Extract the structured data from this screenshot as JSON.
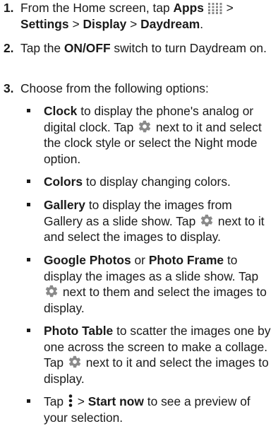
{
  "steps": [
    {
      "number": "1.",
      "parts": {
        "a": "From the Home screen, tap ",
        "b": "Apps",
        "c": " > ",
        "d": "Settings",
        "e": " > ",
        "f": "Display",
        "g": " > ",
        "h": "Daydream",
        "i": "."
      }
    },
    {
      "number": "2.",
      "parts": {
        "a": "Tap the ",
        "b": "ON/OFF",
        "c": " switch to turn Daydream on."
      }
    },
    {
      "number": "3.",
      "parts": {
        "a": "Choose from the following options:"
      }
    }
  ],
  "options": [
    {
      "parts": {
        "a": "Clock",
        "b": " to display the phone's analog or digital clock. Tap ",
        "c": " next to it and select the clock style or select the Night mode option."
      }
    },
    {
      "parts": {
        "a": "Colors",
        "b": " to display changing colors."
      }
    },
    {
      "parts": {
        "a": "Gallery",
        "b": " to display the images from Gallery as a slide show. Tap ",
        "c": " next to it and select the images to display."
      }
    },
    {
      "parts": {
        "a": "Google Photos",
        "b": " or ",
        "c": "Photo Frame",
        "d": " to display the images as a slide show. Tap ",
        "e": " next to them and select the images to display."
      }
    },
    {
      "parts": {
        "a": "Photo Table",
        "b": " to scatter the images one by one across the screen to make a collage. Tap ",
        "c": " next to it and select the images to display."
      }
    },
    {
      "parts": {
        "a": "Tap ",
        "b": " > ",
        "c": "Start now",
        "d": " to see a preview of your selection."
      }
    }
  ],
  "icons": {
    "apps": "apps-grid-icon",
    "settings": "gear-icon",
    "menu": "more-vertical-icon"
  },
  "colors": {
    "text": "#1a1a1a"
  }
}
